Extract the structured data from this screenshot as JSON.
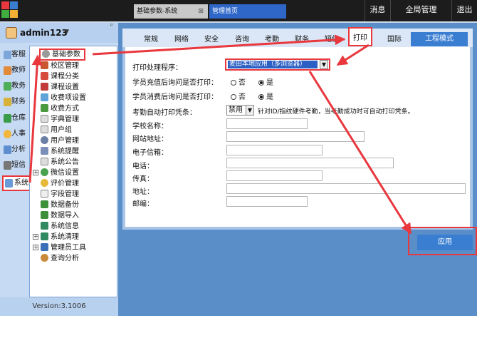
{
  "topbar": {
    "tabs": [
      {
        "label": "基础参数-系统",
        "close": "⊠"
      },
      {
        "label": "管理首页"
      }
    ],
    "buttons": [
      "消息",
      "全局管理",
      "退出"
    ]
  },
  "user": {
    "name": "admin123",
    "caret": "▼",
    "pin": "ᵖ"
  },
  "categories": [
    "客服",
    "教师",
    "教务",
    "财务",
    "仓库",
    "人事",
    "分析",
    "短信",
    "系统"
  ],
  "tree": [
    "基础参数",
    "校区管理",
    "课程分类",
    "课程设置",
    "收费项设置",
    "收费方式",
    "字典管理",
    "用户组",
    "用户管理",
    "系统提醒",
    "系统公告",
    "微信设置",
    "评价管理",
    "字段管理",
    "数据备份",
    "数据导入",
    "系统信息",
    "系统清理",
    "管理员工具",
    "查询分析"
  ],
  "version": "Version:3.1006",
  "main_tabs": [
    "常规",
    "网络",
    "安全",
    "咨询",
    "考勤",
    "财务",
    "短信",
    "打印",
    "国际"
  ],
  "mode_button": "工程模式",
  "form": {
    "print_label": "打印处理程序：",
    "print_value": "麦田本地应用（多浏览器）",
    "recharge_label": "学员充值后询问是否打印：",
    "consume_label": "学员消费后询问是否打印：",
    "no": "否",
    "yes": "是",
    "attend_label": "考勤自动打印凭条：",
    "attend_value": "禁用",
    "attend_hint": "针对ID/指纹硬件考勤，当考勤成功时可自动打印凭条。",
    "school_label": "学校名称：",
    "website_label": "网站地址：",
    "email_label": "电子信箱：",
    "phone_label": "电话：",
    "fax_label": "传真：",
    "address_label": "地址：",
    "postcode_label": "邮编："
  },
  "apply_button": "应用",
  "colors": {
    "highlight": "#e8373d",
    "accent": "#3a7ed2",
    "selected": "#2d60c4"
  }
}
